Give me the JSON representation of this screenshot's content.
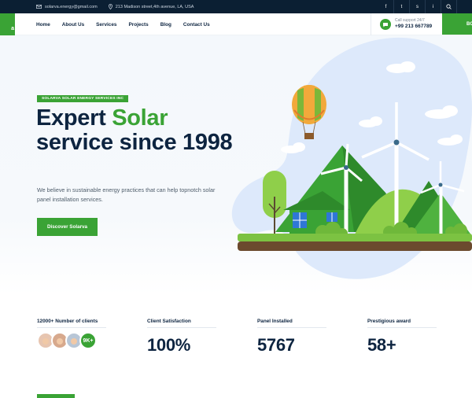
{
  "topbar": {
    "email": "solarva.energy@gmail.com",
    "address": "213 Madison street,4th avenue, LA, USA",
    "social": [
      "f",
      "t",
      "s",
      "i"
    ]
  },
  "logo_fragment": "a",
  "nav": {
    "items": [
      "Home",
      "About Us",
      "Services",
      "Projects",
      "Blog",
      "Contact Us"
    ],
    "support_label": "Call support 24/7",
    "support_phone": "+99 213 667789",
    "cta_fragment": "BO"
  },
  "hero": {
    "badge": "SOLARVA SOLAR ENERGY SERVICES INC",
    "headline_1": "Expert ",
    "headline_green": "Solar",
    "headline_2": "service since 1998",
    "description": "We believe in sustainable energy practices that can help topnotch solar panel installation services.",
    "button": "Discover Solarva"
  },
  "stats": [
    {
      "label": "12000+ Number of clients",
      "value": "",
      "avatar_count": "9K+"
    },
    {
      "label": "Client Satisfaction",
      "value": "100%"
    },
    {
      "label": "Panel Installed",
      "value": "5767"
    },
    {
      "label": "Prestigious award",
      "value": "58+"
    }
  ],
  "colors": {
    "accent": "#3aa335",
    "dark": "#0b1f33",
    "text": "#0d2440"
  }
}
